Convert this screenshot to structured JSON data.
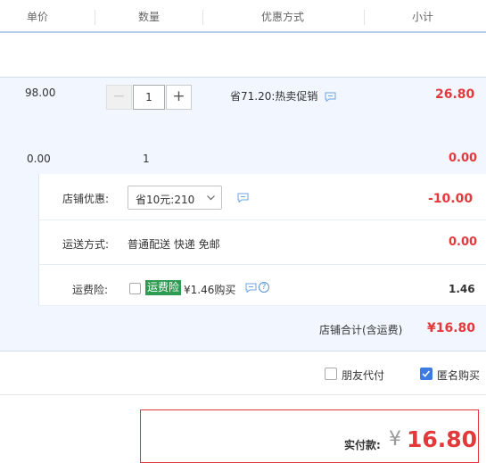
{
  "header": {
    "col_price": "单价",
    "col_qty": "数量",
    "col_discount": "优惠方式",
    "col_subtotal": "小计"
  },
  "item": {
    "unit_price": "98.00",
    "qty_minus": "−",
    "qty_value": "1",
    "qty_plus": "+",
    "promo_text": "省71.20:热卖促销",
    "subtotal": "26.80"
  },
  "gift": {
    "unit_price": "0.00",
    "qty": "1",
    "subtotal": "0.00"
  },
  "store": {
    "discount_label": "店铺优惠:",
    "discount_select_value": "省10元:210",
    "discount_amount": "-10.00",
    "shipping_label": "运送方式:",
    "shipping_text": "普通配送 快递 免邮",
    "shipping_amount": "0.00",
    "insurance_label": "运费险:",
    "insurance_tag": "运费险",
    "insurance_text": "¥1.46购买",
    "insurance_help": "?",
    "insurance_amount": "1.46",
    "store_total_label": "店铺合计(含运费)",
    "store_total_value": "¥16.80"
  },
  "options": {
    "friend_pay_label": "朋友代付",
    "friend_pay_checked": false,
    "anonymous_label": "匿名购买",
    "anonymous_checked": true
  },
  "payment": {
    "label": "实付款:",
    "currency": "¥",
    "amount": "16.80"
  },
  "colors": {
    "price_red": "#e4393c",
    "header_line": "#b7cce9",
    "row_bg": "#f2f7ff",
    "insurance_green": "#2e9b52",
    "checkbox_blue": "#3d7be3"
  }
}
